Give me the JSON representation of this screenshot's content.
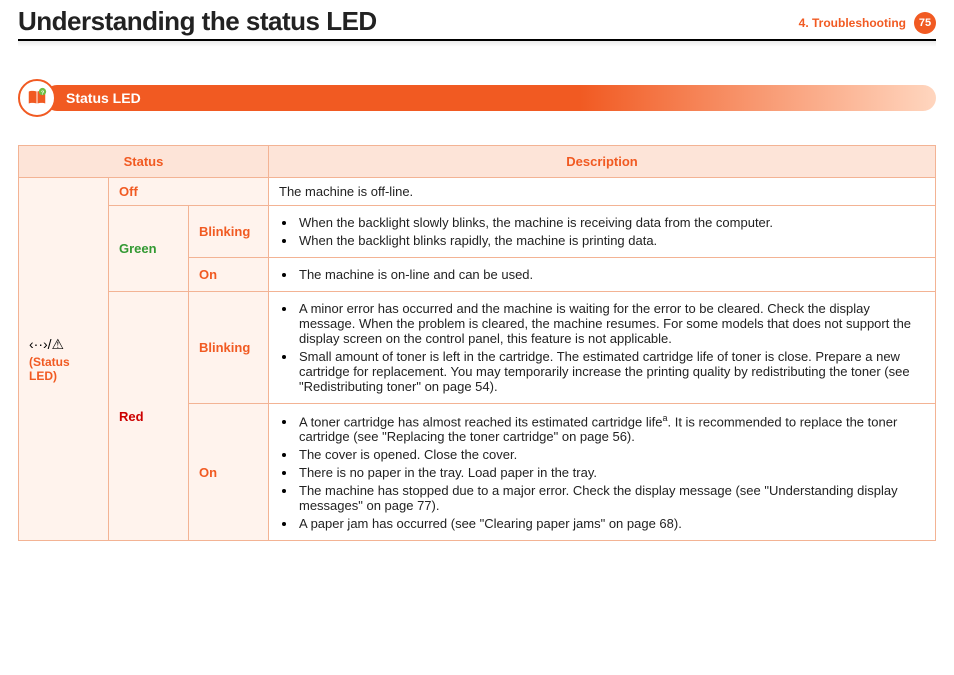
{
  "header": {
    "title": "Understanding the status LED",
    "chapter": "4.  Troubleshooting",
    "page": "75"
  },
  "section": {
    "title": "Status LED"
  },
  "table": {
    "head": {
      "status": "Status",
      "description": "Description"
    },
    "led_glyph": "‹··›/⚠",
    "led_label": "(Status LED)",
    "rows": {
      "off": {
        "color": "Off",
        "state": "",
        "desc_plain": "The machine is off-line."
      },
      "green_blink": {
        "color": "Green",
        "state": "Blinking",
        "items": [
          "When the backlight slowly blinks, the machine is receiving data from the computer.",
          "When the backlight blinks rapidly, the machine is printing data."
        ]
      },
      "green_on": {
        "state": "On",
        "items": [
          "The machine is on-line and can be used."
        ]
      },
      "red_blink": {
        "color": "Red",
        "state": "Blinking",
        "items": [
          "A minor error has occurred and the machine is waiting for the error to be cleared. Check the display message. When the problem is cleared, the machine resumes. For some models that does not support the display screen on the control panel, this feature is not applicable.",
          "Small amount of toner is left in the cartridge. The estimated cartridge life of toner is close. Prepare a new cartridge for replacement. You may temporarily increase the printing quality by redistributing the toner (see \"Redistributing toner\" on page 54)."
        ]
      },
      "red_on": {
        "state": "On",
        "items_pre": "A toner cartridge has almost reached its estimated cartridge life",
        "items_post": ". It is recommended to replace the toner cartridge (see \"Replacing the toner cartridge\" on page 56).",
        "foot": "a",
        "items": [
          "The cover is opened. Close the cover.",
          "There is no paper in the tray. Load paper in the tray.",
          "The machine has stopped due to a major error. Check the display message (see \"Understanding display messages\" on page 77).",
          "A paper jam has occurred (see \"Clearing paper jams\" on page 68)."
        ]
      }
    }
  }
}
